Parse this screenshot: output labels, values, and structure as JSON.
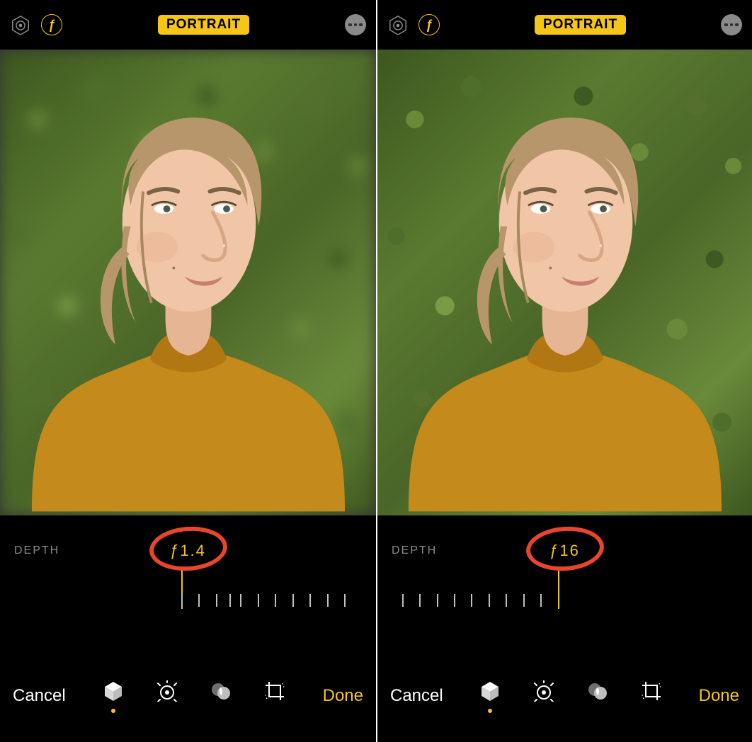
{
  "colors": {
    "accent": "#f5c518",
    "annotation": "#e8452a"
  },
  "screens": [
    {
      "id": "left",
      "mode_label": "PORTRAIT",
      "depth_label": "DEPTH",
      "f_value": "ƒ1.4",
      "background_blur": true,
      "indicator_pct": 48,
      "ticks_pct": [
        48,
        53,
        58,
        62,
        65,
        70,
        75,
        80,
        85,
        90,
        95
      ],
      "toolbar": {
        "cancel": "Cancel",
        "done": "Done"
      }
    },
    {
      "id": "right",
      "mode_label": "PORTRAIT",
      "depth_label": "DEPTH",
      "f_value": "ƒ16",
      "background_blur": false,
      "indicator_pct": 48,
      "ticks_pct": [
        3,
        8,
        13,
        18,
        23,
        28,
        33,
        38,
        43
      ],
      "toolbar": {
        "cancel": "Cancel",
        "done": "Done"
      }
    }
  ]
}
